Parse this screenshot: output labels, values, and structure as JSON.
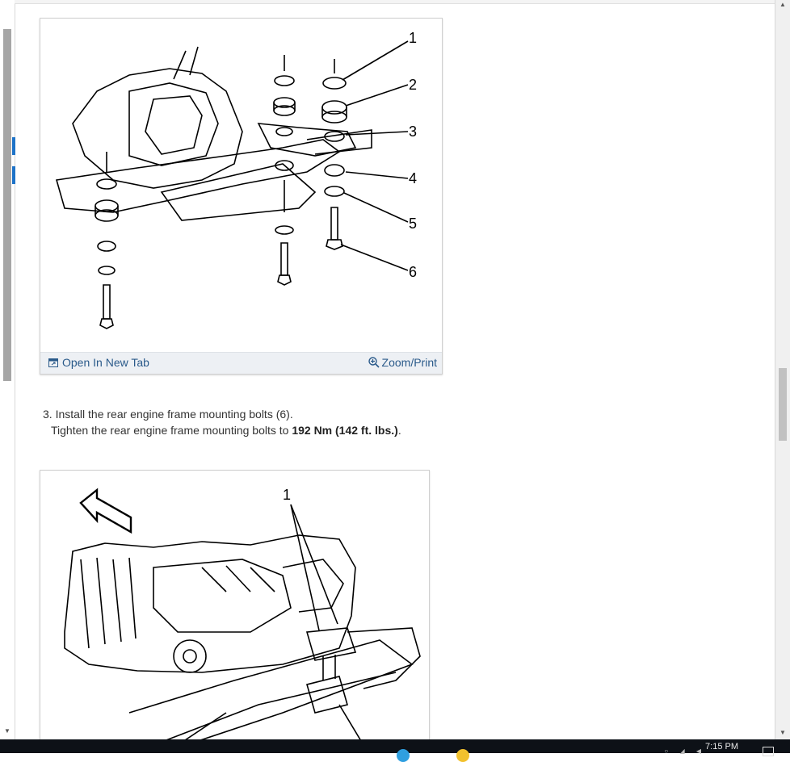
{
  "figure1": {
    "callouts": [
      "1",
      "2",
      "3",
      "4",
      "5",
      "6"
    ],
    "open_tab_label": "Open In New Tab",
    "zoom_print_label": "Zoom/Print"
  },
  "step": {
    "line1": "3. Install the rear engine frame mounting bolts (6).",
    "line2_prefix": "Tighten the rear engine frame mounting bolts to ",
    "torque": "192 Nm (142 ft. lbs.)",
    "line2_suffix": "."
  },
  "figure2": {
    "callouts": [
      "1"
    ]
  },
  "taskbar": {
    "clock": "7:15 PM"
  },
  "colors": {
    "link": "#2a5a8a",
    "footer_bg": "#edf0f4",
    "taskbar_bg": "#0d1117"
  },
  "icons": [
    "open-new-tab-icon",
    "zoom-icon",
    "scroll-up-icon",
    "scroll-down-icon"
  ]
}
